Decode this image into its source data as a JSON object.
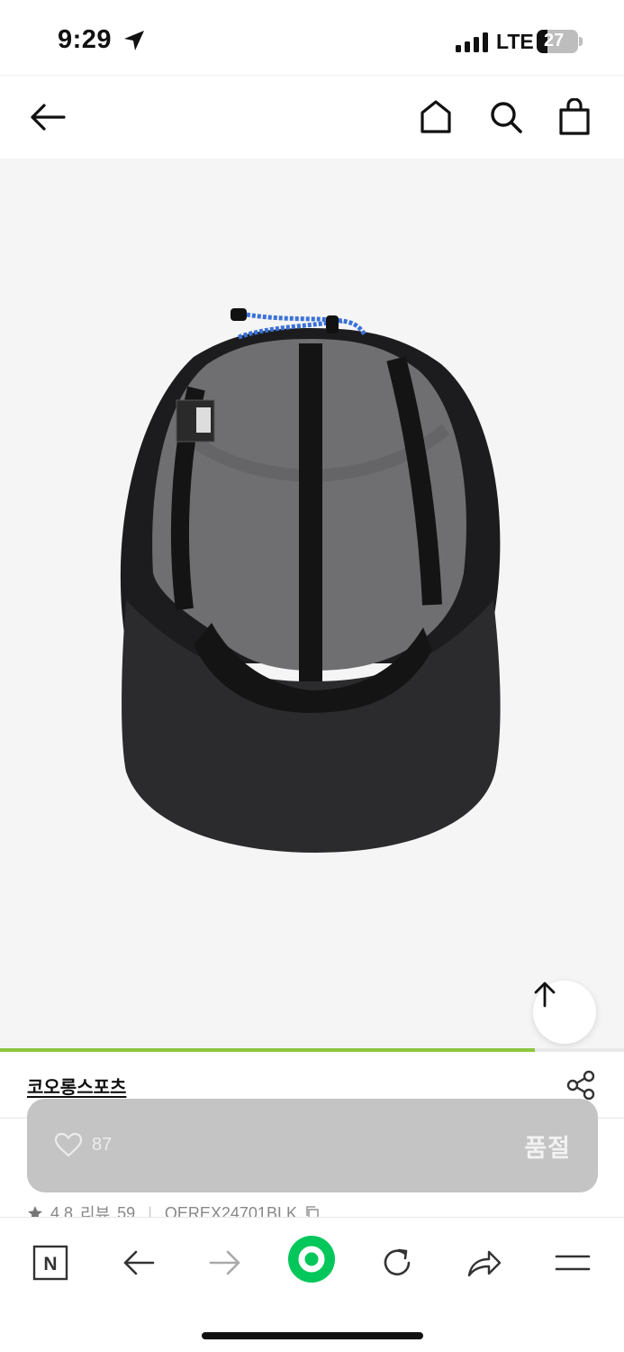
{
  "status_bar": {
    "time": "9:29",
    "carrier": "LTE",
    "battery_level": "27",
    "icons": [
      "location-arrow-icon",
      "signal-bars-icon",
      "battery-icon"
    ]
  },
  "top_nav": {
    "icons": [
      "back-arrow-icon",
      "home-icon",
      "search-icon",
      "shopping-bag-icon"
    ]
  },
  "product": {
    "brand": "코오롱스포츠",
    "image_alt_icon": "cap-product-image",
    "rating": "4.8",
    "reviews_label": "리뷰",
    "review_count": "59",
    "product_code": "QEREX24701BLK",
    "image_scroll_progress": 0.857
  },
  "purchase_bar": {
    "wish_count": "87",
    "status_label": "품절"
  },
  "toolbar": {
    "icons": [
      "naver-n-icon",
      "back-icon",
      "forward-icon",
      "green-dot-icon",
      "reload-icon",
      "share-icon",
      "menu-icon"
    ]
  },
  "colors": {
    "accent_green": "#8cc63e",
    "naver_green": "#03c75a",
    "purchase_bar_gray": "#c4c4c4",
    "image_bg": "#f5f5f5"
  }
}
